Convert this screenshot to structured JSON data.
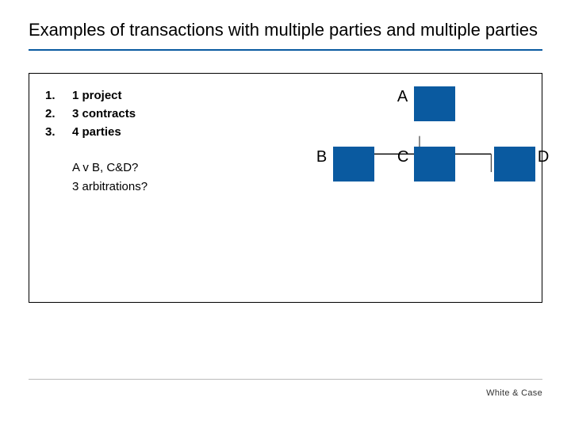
{
  "title": "Examples of transactions with multiple parties and multiple parties",
  "list": {
    "items": [
      {
        "num": "1.",
        "text": "1 project"
      },
      {
        "num": "2.",
        "text": "3 contracts"
      },
      {
        "num": "3.",
        "text": "4 parties"
      }
    ]
  },
  "questions": {
    "line1": "A v B, C&D?",
    "line2": "3 arbitrations?"
  },
  "diagram": {
    "nodes": {
      "a": "A",
      "b": "B",
      "c": "C",
      "d": "D"
    }
  },
  "footer": {
    "brand": "White & Case"
  },
  "colors": {
    "accent": "#0a5aa0"
  }
}
